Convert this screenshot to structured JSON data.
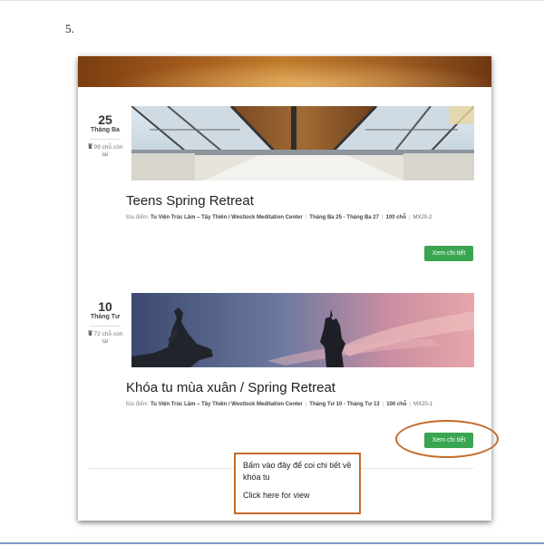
{
  "step_number": "5.",
  "events": [
    {
      "day": "25",
      "month": "Tháng Ba",
      "seats": "99 chỗ còn lại",
      "title": "Teens Spring Retreat",
      "place_label": "Địa điểm:",
      "place": "Tu Viện Trúc Lâm – Tây Thiên / Westlock Meditation Center",
      "dates": "Tháng Ba 25 - Tháng Ba 27",
      "capacity": "100 chỗ",
      "code": "MX20-2",
      "button": "Xem chi tiết"
    },
    {
      "day": "10",
      "month": "Tháng Tư",
      "seats": "72 chỗ còn lại",
      "title": "Khóa tu mùa xuân / Spring Retreat",
      "place_label": "Địa điểm:",
      "place": "Tu Viện Trúc Lâm – Tây Thiên / Westlock Meditation Center",
      "dates": "Tháng Tư 10 - Tháng Tư 13",
      "capacity": "100 chỗ",
      "code": "MX20-1",
      "button": "Xem chi tiết"
    }
  ],
  "callout": {
    "vi": "Bấm vào đây để coi chi tiết về khóa tu",
    "en": "Click here for view"
  },
  "icons": {
    "seats": "trash-icon"
  },
  "colors": {
    "button": "#3aa551",
    "annotation": "#c46a2c"
  }
}
